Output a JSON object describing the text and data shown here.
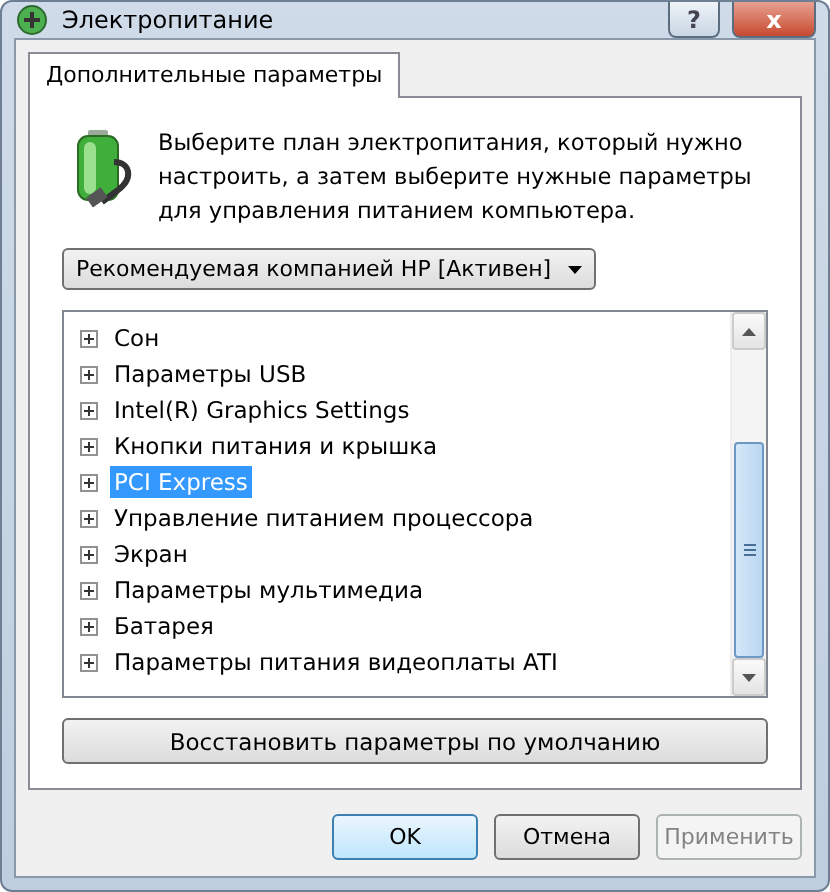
{
  "window": {
    "title": "Электропитание",
    "buttons": [
      "?",
      "x"
    ]
  },
  "tabs": [
    {
      "label": "Дополнительные параметры",
      "selected": true
    }
  ],
  "description": "Выберите план электропитания, который нужно настроить, а затем выберите нужные параметры для управления питанием компьютера.",
  "plan_dropdown": {
    "value": "Рекомендуемая компанией HP [Активен]"
  },
  "settings_tree": [
    {
      "label": "Сон",
      "expanded": false,
      "selected": false
    },
    {
      "label": "Параметры USB",
      "expanded": false,
      "selected": false
    },
    {
      "label": "Intel(R) Graphics Settings",
      "expanded": false,
      "selected": false
    },
    {
      "label": "Кнопки питания и крышка",
      "expanded": false,
      "selected": false
    },
    {
      "label": "PCI Express",
      "expanded": false,
      "selected": true
    },
    {
      "label": "Управление питанием процессора",
      "expanded": false,
      "selected": false
    },
    {
      "label": "Экран",
      "expanded": false,
      "selected": false
    },
    {
      "label": "Параметры мультимедиа",
      "expanded": false,
      "selected": false
    },
    {
      "label": "Батарея",
      "expanded": false,
      "selected": false
    },
    {
      "label": "Параметры питания видеоплаты ATI",
      "expanded": false,
      "selected": false
    }
  ],
  "restore_button": "Восстановить параметры по умолчанию",
  "buttons": [
    {
      "label": "OK",
      "disabled": false
    },
    {
      "label": "Отмена",
      "disabled": false
    },
    {
      "label": "Применить",
      "disabled": true
    }
  ]
}
